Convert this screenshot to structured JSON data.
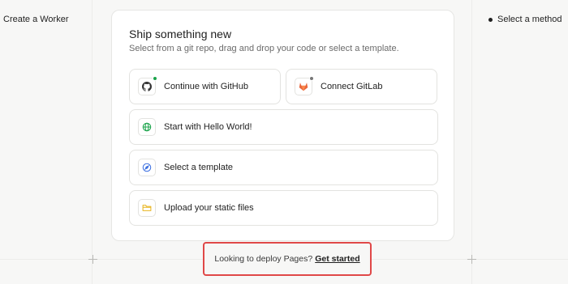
{
  "left_panel": {
    "title": "Create a Worker"
  },
  "steps": [
    {
      "label": "Select a method"
    }
  ],
  "card": {
    "title": "Ship something new",
    "subtitle": "Select from a git repo, drag and drop your code or select a template.",
    "options": [
      {
        "label": "Continue with GitHub",
        "icon": "github-icon",
        "status": "connected",
        "status_color": "#1aa34a"
      },
      {
        "label": "Connect GitLab",
        "icon": "gitlab-icon",
        "status": "not-connected",
        "status_color": "#777777"
      },
      {
        "label": "Start with Hello World!",
        "icon": "globe-icon"
      },
      {
        "label": "Select a template",
        "icon": "compass-icon"
      },
      {
        "label": "Upload your static files",
        "icon": "folder-icon"
      }
    ]
  },
  "pages_prompt": {
    "text": "Looking to deploy Pages?",
    "link": "Get started"
  },
  "colors": {
    "accent_green": "#1aa34a",
    "highlight_red": "#e04848",
    "gitlab_orange": "#e8673d",
    "globe_green": "#1aa34a",
    "compass_blue": "#3b6fe0",
    "folder_yellow": "#e8b520"
  }
}
